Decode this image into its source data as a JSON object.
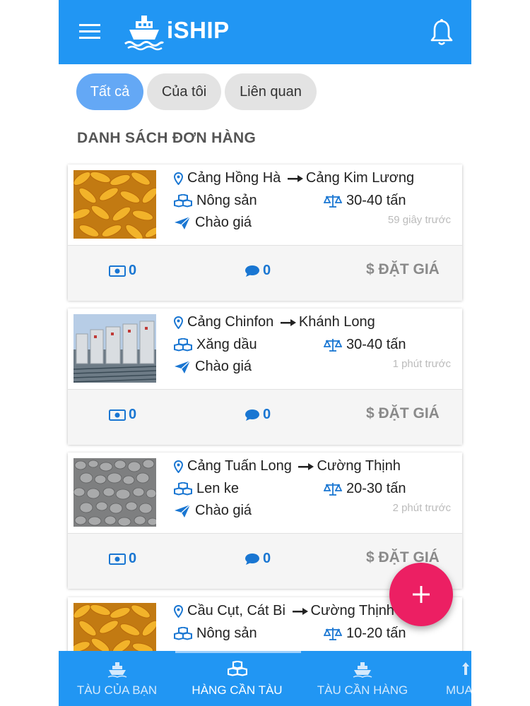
{
  "app": {
    "title": "iSHIP"
  },
  "filters": {
    "items": [
      "Tất cả",
      "Của tôi",
      "Liên quan"
    ],
    "active": "Tất cả"
  },
  "section_title": "DANH SÁCH ĐƠN HÀNG",
  "orders": [
    {
      "from": "Cảng Hồng Hà",
      "to": "Cảng Kim Lương",
      "cargo": "Nông sản",
      "weight": "30-40 tấn",
      "price_mode": "Chào giá",
      "time": "59 giây trước",
      "money_count": "0",
      "comment_count": "0",
      "bid_label": "$ ĐẶT GIÁ",
      "image": "corn"
    },
    {
      "from": "Cảng Chinfon",
      "to": "Khánh Long",
      "cargo": "Xăng dầu",
      "weight": "30-40 tấn",
      "price_mode": "Chào giá",
      "time": "1 phút trước",
      "money_count": "0",
      "comment_count": "0",
      "bid_label": "$ ĐẶT GIÁ",
      "image": "silos"
    },
    {
      "from": "Cảng Tuấn Long",
      "to": "Cường Thịnh",
      "cargo": "Len ke",
      "weight": "20-30 tấn",
      "price_mode": "Chào giá",
      "time": "2 phút trước",
      "money_count": "0",
      "comment_count": "0",
      "bid_label": "$ ĐẶT GIÁ",
      "image": "gravel"
    },
    {
      "from": "Cầu Cụt, Cát Bi",
      "to": "Cường Thịnh",
      "cargo": "Nông sản",
      "weight": "10-20 tấn",
      "image": "corn"
    }
  ],
  "bottom_nav": [
    {
      "label": "TÀU CỦA BẠN",
      "icon": "ship-icon"
    },
    {
      "label": "HÀNG CẦN TÀU",
      "icon": "cubes-icon",
      "active": true
    },
    {
      "label": "TÀU CẦN HÀNG",
      "icon": "ship-icon"
    },
    {
      "label": "MUA",
      "icon": "arrows-icon"
    }
  ],
  "colors": {
    "primary": "#2196F3",
    "fab": "#EC1F63",
    "icon_blue": "#1976D2",
    "chip_active": "#64A8F5"
  }
}
